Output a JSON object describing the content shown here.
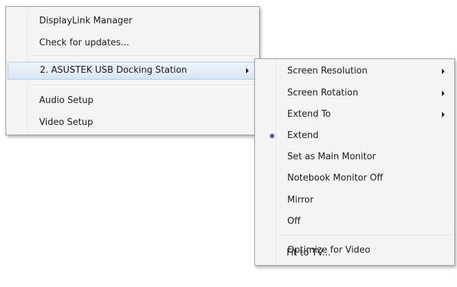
{
  "main_menu": {
    "items": [
      {
        "label": "DisplayLink Manager"
      },
      {
        "label": "Check for updates..."
      },
      {
        "label": "2. ASUSTEK USB Docking Station"
      },
      {
        "label": "Audio Setup"
      },
      {
        "label": "Video Setup"
      }
    ]
  },
  "sub_menu": {
    "items": [
      {
        "label": "Screen Resolution"
      },
      {
        "label": "Screen Rotation"
      },
      {
        "label": "Extend To"
      },
      {
        "label": "Extend",
        "selected": true
      },
      {
        "label": "Set as Main Monitor"
      },
      {
        "label": "Notebook Monitor Off"
      },
      {
        "label": "Mirror"
      },
      {
        "label": "Off"
      },
      {
        "label": "Optimize for Video"
      },
      {
        "label": "Fit to TV..."
      }
    ]
  },
  "colors": {
    "menu_background": "#f4f4f4",
    "highlight": "#dbe6f4",
    "radio_dot": "#4a5f9a"
  }
}
